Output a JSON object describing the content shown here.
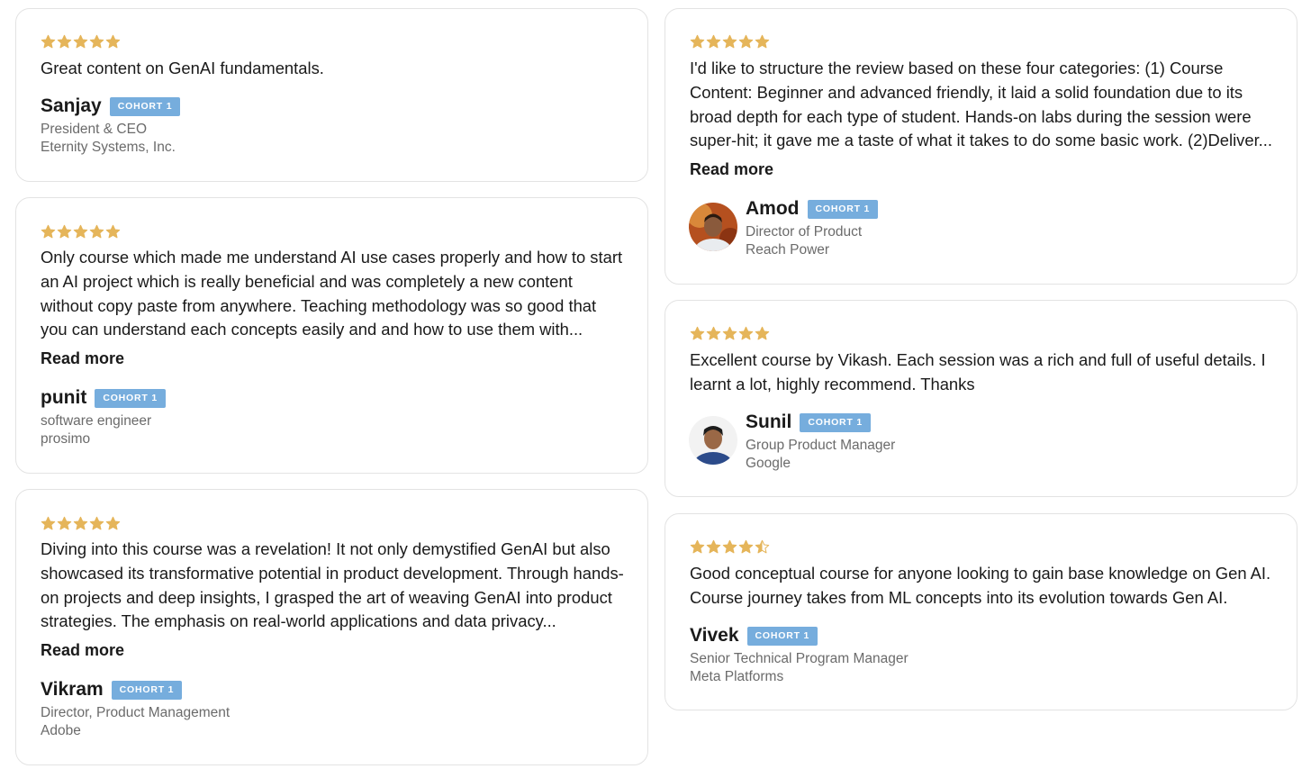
{
  "colors": {
    "star": "#e5b55a",
    "badge": "#76addd",
    "border": "#e3e3e3",
    "muted": "#6b6b6b"
  },
  "read_more_label": "Read more",
  "reviews": [
    {
      "rating": 5,
      "text": "Great content on GenAI fundamentals.",
      "name": "Sanjay",
      "badge": "COHORT 1",
      "role": "President & CEO",
      "company": "Eternity Systems, Inc."
    },
    {
      "rating": 5,
      "text": "Only course which made me understand AI use cases properly and how to start an AI project which is really beneficial and was completely a new content without copy paste from anywhere. Teaching methodology was so good that you can understand each concepts easily and and how to use them with...",
      "name": "punit",
      "badge": "COHORT 1",
      "role": "software engineer",
      "company": "prosimo"
    },
    {
      "rating": 5,
      "text": "Diving into this course was a revelation! It not only demystified GenAI but also showcased its transformative potential in product development. Through hands-on projects and deep insights, I grasped the art of weaving GenAI into product strategies. The emphasis on real-world applications and data privacy...",
      "name": "Vikram",
      "badge": "COHORT 1",
      "role": "Director, Product Management",
      "company": "Adobe"
    },
    {
      "rating": 5,
      "text": "I'd like to structure the review based on these four categories: (1) Course Content: Beginner and advanced friendly, it laid a solid foundation due to its broad depth for each type of student. Hands-on labs during the session were super-hit; it gave me a taste of what it takes to do some basic work. (2)Deliver...",
      "name": "Amod",
      "badge": "COHORT 1",
      "role": "Director of Product",
      "company": "Reach Power"
    },
    {
      "rating": 5,
      "text": "Excellent course by Vikash. Each session was a rich and full of useful details. I learnt a lot, highly recommend. Thanks",
      "name": "Sunil",
      "badge": "COHORT 1",
      "role": "Group Product Manager",
      "company": "Google"
    },
    {
      "rating": 4.5,
      "text": "Good conceptual course for anyone looking to gain base knowledge on Gen AI. Course journey takes from ML concepts into its evolution towards Gen AI.",
      "name": "Vivek",
      "badge": "COHORT 1",
      "role": "Senior Technical Program Manager",
      "company": "Meta Platforms"
    }
  ]
}
